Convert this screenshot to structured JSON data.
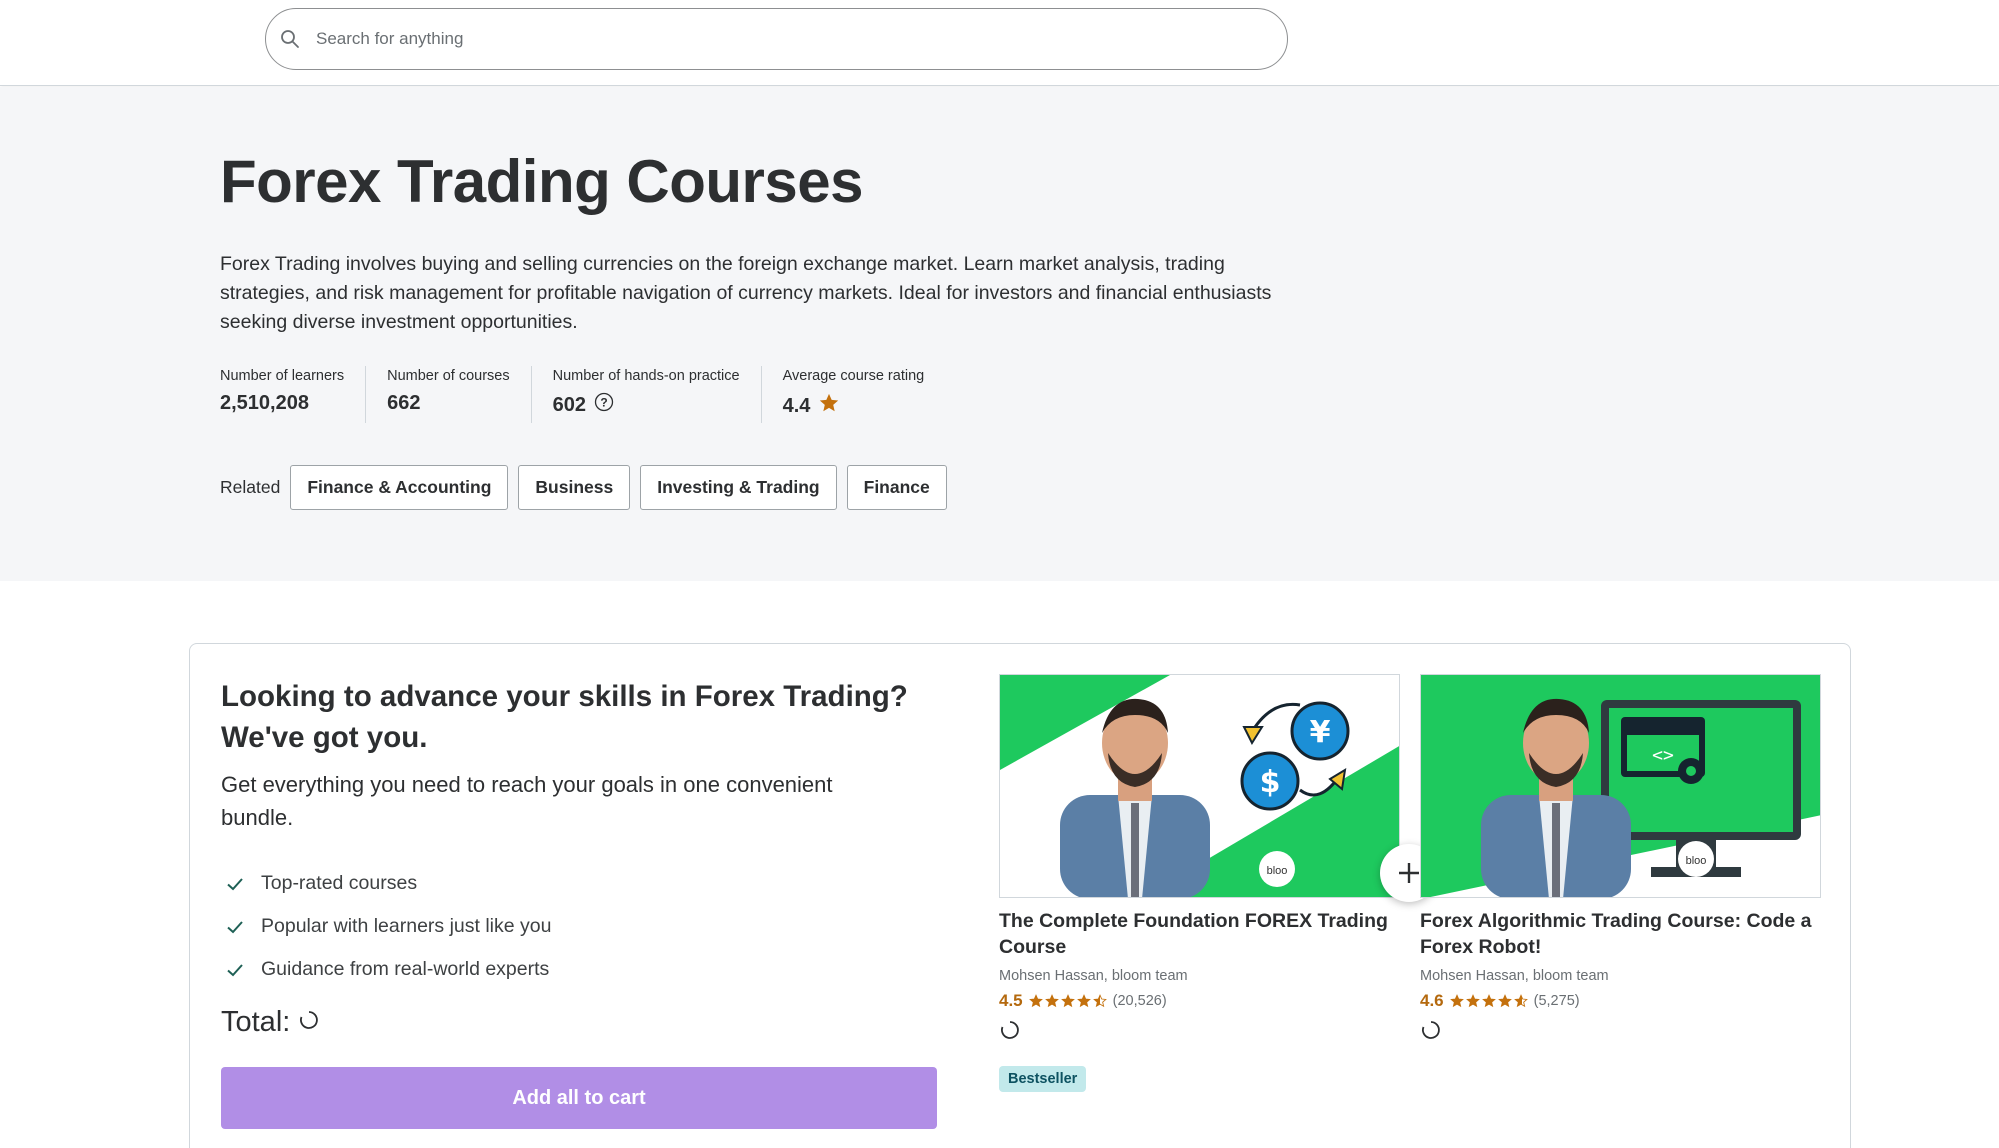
{
  "search": {
    "placeholder": "Search for anything"
  },
  "hero": {
    "title": "Forex Trading Courses",
    "description": "Forex Trading involves buying and selling currencies on the foreign exchange market. Learn market analysis, trading strategies, and risk management for profitable navigation of currency markets. Ideal for investors and financial enthusiasts seeking diverse investment opportunities.",
    "stats": [
      {
        "label": "Number of learners",
        "value": "2,510,208"
      },
      {
        "label": "Number of courses",
        "value": "662"
      },
      {
        "label": "Number of hands-on practice",
        "value": "602"
      },
      {
        "label": "Average course rating",
        "value": "4.4"
      }
    ],
    "related_label": "Related",
    "related": [
      "Finance & Accounting",
      "Business",
      "Investing & Trading",
      "Finance"
    ]
  },
  "bundle": {
    "heading": "Looking to advance your skills in Forex Trading? We've got you.",
    "subheading": "Get everything you need to reach your goals in one convenient bundle.",
    "checks": [
      "Top-rated courses",
      "Popular with learners just like you",
      "Guidance from real-world experts"
    ],
    "total_label": "Total:",
    "add_button": "Add all to cart",
    "courses": [
      {
        "title": "The Complete Foundation FOREX Trading Course",
        "instructors": "Mohsen Hassan, bloom team",
        "rating": "4.5",
        "rating_value": 4.5,
        "reviews": "(20,526)",
        "badge": "Bestseller",
        "logo_text": "bloo"
      },
      {
        "title": "Forex Algorithmic Trading Course: Code a Forex Robot!",
        "instructors": "Mohsen Hassan, bloom team",
        "rating": "4.6",
        "rating_value": 4.6,
        "reviews": "(5,275)",
        "badge": "",
        "logo_text": "bloo"
      }
    ]
  },
  "colors": {
    "accent_purple": "#b18ee6",
    "star": "#b4690e",
    "thumb_green": "#1ec95e",
    "badge_bg": "#c2e9eb"
  }
}
